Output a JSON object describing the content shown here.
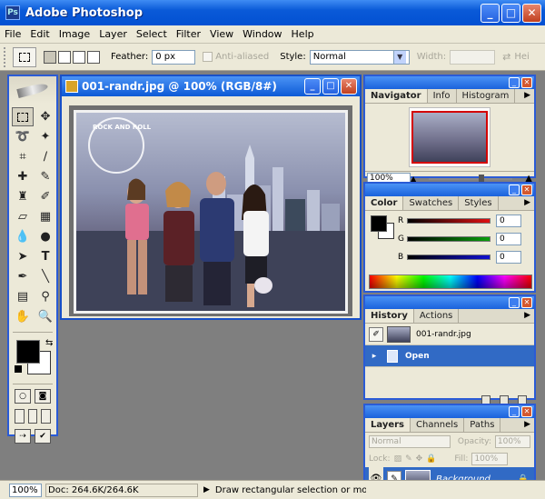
{
  "app": {
    "title": "Adobe Photoshop",
    "icon": "ps-icon"
  },
  "window_controls": {
    "minimize": "_",
    "maximize": "□",
    "close": "✕"
  },
  "menu": [
    "File",
    "Edit",
    "Image",
    "Layer",
    "Select",
    "Filter",
    "View",
    "Window",
    "Help"
  ],
  "options": {
    "feather_label": "Feather:",
    "feather_value": "0 px",
    "antialiased_label": "Anti-aliased",
    "style_label": "Style:",
    "style_value": "Normal",
    "width_label": "Width:",
    "height_label": "Hei"
  },
  "document": {
    "title": "001-randr.jpg @ 100% (RGB/8#)",
    "photo_text": "ROCK AND ROLL"
  },
  "navigator": {
    "tabs": [
      "Navigator",
      "Info",
      "Histogram"
    ],
    "zoom": "100%"
  },
  "color": {
    "tabs": [
      "Color",
      "Swatches",
      "Styles"
    ],
    "r_label": "R",
    "g_label": "G",
    "b_label": "B",
    "r_value": "0",
    "g_value": "0",
    "b_value": "0",
    "colors": {
      "r": "#e01010",
      "g": "#0aa00a",
      "b": "#1010d0"
    }
  },
  "history": {
    "tabs": [
      "History",
      "Actions"
    ],
    "items": [
      {
        "label": "001-randr.jpg"
      },
      {
        "label": "Open"
      }
    ]
  },
  "layers": {
    "tabs": [
      "Layers",
      "Channels",
      "Paths"
    ],
    "blend_mode": "Normal",
    "opacity_label": "Opacity:",
    "opacity_value": "100%",
    "lock_label": "Lock:",
    "fill_label": "Fill:",
    "fill_value": "100%",
    "layer_name": "Background"
  },
  "status": {
    "zoom": "100%",
    "doc": "Doc: 264.6K/264.6K",
    "message": "Draw rectangular selection or move selection"
  }
}
